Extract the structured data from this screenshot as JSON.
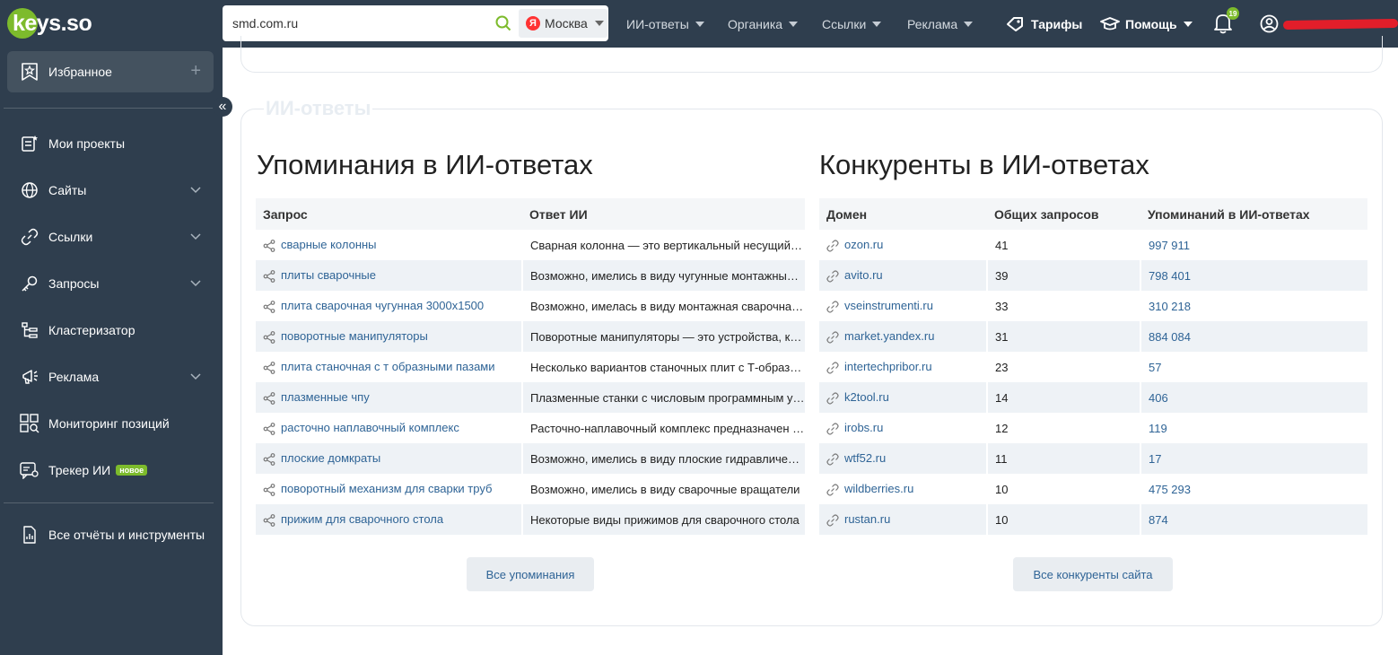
{
  "header": {
    "logo_text": "keys.so",
    "search_value": "smd.com.ru",
    "region": "Москва",
    "nav": [
      "ИИ-ответы",
      "Органика",
      "Ссылки",
      "Реклама"
    ],
    "tariffs": "Тарифы",
    "help": "Помощь",
    "notifications_count": "19"
  },
  "sidebar": {
    "favorites": "Избранное",
    "items": [
      {
        "label": "Мои проекты",
        "icon": "projects-icon",
        "expandable": false
      },
      {
        "label": "Сайты",
        "icon": "globe-icon",
        "expandable": true
      },
      {
        "label": "Ссылки",
        "icon": "link-icon",
        "expandable": true
      },
      {
        "label": "Запросы",
        "icon": "key-icon",
        "expandable": true
      },
      {
        "label": "Кластеризатор",
        "icon": "cluster-icon",
        "expandable": false
      },
      {
        "label": "Реклама",
        "icon": "megaphone-icon",
        "expandable": true
      },
      {
        "label": "Мониторинг позиций",
        "icon": "monitoring-icon",
        "expandable": false
      },
      {
        "label": "Трекер ИИ",
        "icon": "tracker-icon",
        "expandable": false,
        "badge": "новое"
      }
    ],
    "reports": "Все отчёты и инструменты"
  },
  "section_legend": "ИИ-ответы",
  "mentions": {
    "title": "Упоминания в ИИ-ответах",
    "columns": [
      "Запрос",
      "Ответ ИИ"
    ],
    "rows": [
      [
        "сварные колонны",
        "Сварная колонна — это вертикальный несущий элемент"
      ],
      [
        "плиты сварочные",
        "Возможно, имелись в виду чугунные монтажные плиты"
      ],
      [
        "плита сварочная чугунная 3000х1500",
        "Возможно, имелась в виду монтажная сварочная плита"
      ],
      [
        "поворотные манипуляторы",
        "Поворотные манипуляторы — это устройства, которые"
      ],
      [
        "плита станочная с т образными пазами",
        "Несколько вариантов станочных плит с Т-образными пазами"
      ],
      [
        "плазменные чпу",
        "Плазменные станки с числовым программным управлением"
      ],
      [
        "расточно наплавочный комплекс",
        "Расточно-наплавочный комплекс предназначен для"
      ],
      [
        "плоские домкраты",
        "Возможно, имелись в виду плоские гидравлические домкраты"
      ],
      [
        "поворотный механизм для сварки труб",
        "Возможно, имелись в виду сварочные вращатели"
      ],
      [
        "прижим для сварочного стола",
        "Некоторые виды прижимов для сварочного стола"
      ]
    ],
    "button": "Все упоминания"
  },
  "competitors": {
    "title": "Конкуренты в ИИ-ответах",
    "columns": [
      "Домен",
      "Общих запросов",
      "Упоминаний в ИИ-ответах"
    ],
    "rows": [
      [
        "ozon.ru",
        "41",
        "997 911"
      ],
      [
        "avito.ru",
        "39",
        "798 401"
      ],
      [
        "vseinstrumenti.ru",
        "33",
        "310 218"
      ],
      [
        "market.yandex.ru",
        "31",
        "884 084"
      ],
      [
        "intertechpribor.ru",
        "23",
        "57"
      ],
      [
        "k2tool.ru",
        "14",
        "406"
      ],
      [
        "irobs.ru",
        "12",
        "119"
      ],
      [
        "wtf52.ru",
        "11",
        "17"
      ],
      [
        "wildberries.ru",
        "10",
        "475 293"
      ],
      [
        "rustan.ru",
        "10",
        "874"
      ]
    ],
    "button": "Все конкуренты сайта"
  },
  "colors": {
    "sidebar_bg": "#2f3e4e",
    "accent_green": "#7dbb2c",
    "link_blue": "#2f6496",
    "row_alt": "#eef2f6"
  }
}
